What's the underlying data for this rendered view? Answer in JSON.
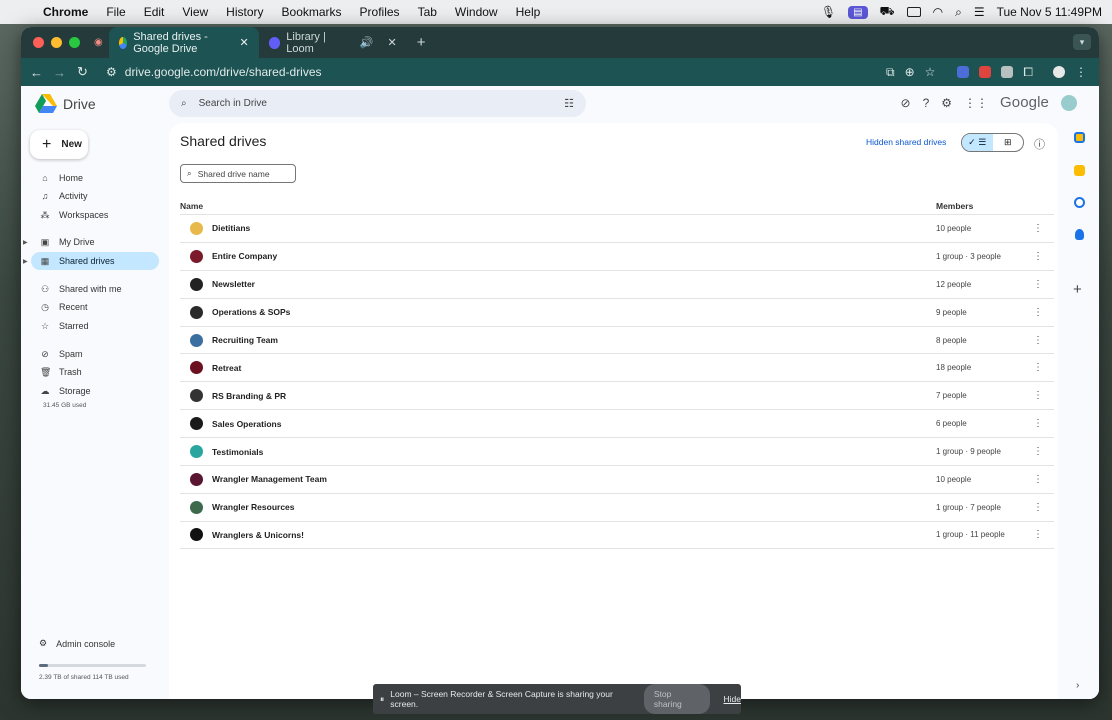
{
  "menubar": {
    "app": "Chrome",
    "items": [
      "File",
      "Edit",
      "View",
      "History",
      "Bookmarks",
      "Profiles",
      "Tab",
      "Window",
      "Help"
    ],
    "clock": "Tue Nov 5  11:49PM"
  },
  "tabs": [
    {
      "label": "Shared drives - Google Drive",
      "active": true
    },
    {
      "label": "Library | Loom",
      "active": false
    }
  ],
  "address": {
    "url": "drive.google.com/drive/shared-drives"
  },
  "drive": {
    "logo": "Drive",
    "new_label": "New",
    "search_placeholder": "Search in Drive",
    "google": "Google",
    "nav": [
      {
        "label": "Home",
        "icon": "home-icon"
      },
      {
        "label": "Activity",
        "icon": "bell-icon"
      },
      {
        "label": "Workspaces",
        "icon": "workspaces-icon"
      },
      {
        "label": "My Drive",
        "icon": "my-drive-icon"
      },
      {
        "label": "Shared drives",
        "icon": "shared-drives-icon"
      },
      {
        "label": "Shared with me",
        "icon": "people-icon"
      },
      {
        "label": "Recent",
        "icon": "clock-icon"
      },
      {
        "label": "Starred",
        "icon": "star-icon"
      },
      {
        "label": "Spam",
        "icon": "spam-icon"
      },
      {
        "label": "Trash",
        "icon": "trash-icon"
      },
      {
        "label": "Storage",
        "icon": "cloud-icon"
      }
    ],
    "storage_used": "31.45 GB used",
    "admin_label": "Admin console",
    "shared_storage": "2.39 TB of shared 114 TB used",
    "shared_storage_fraction": 0.021,
    "page_title": "Shared drives",
    "hidden_link": "Hidden shared drives",
    "drive_search_placeholder": "Shared drive name",
    "columns": {
      "name": "Name",
      "members": "Members"
    },
    "rows": [
      {
        "name": "Dietitians",
        "members": "10 people",
        "color": "#e6b94a"
      },
      {
        "name": "Entire Company",
        "members": "1 group · 3 people",
        "color": "#7a1a2a"
      },
      {
        "name": "Newsletter",
        "members": "12 people",
        "color": "#222222"
      },
      {
        "name": "Operations & SOPs",
        "members": "9 people",
        "color": "#2b2b2b"
      },
      {
        "name": "Recruiting Team",
        "members": "8 people",
        "color": "#3a6fa0"
      },
      {
        "name": "Retreat",
        "members": "18 people",
        "color": "#6a1020"
      },
      {
        "name": "RS Branding & PR",
        "members": "7 people",
        "color": "#333333"
      },
      {
        "name": "Sales Operations",
        "members": "6 people",
        "color": "#1a1a1a"
      },
      {
        "name": "Testimonials",
        "members": "1 group · 9 people",
        "color": "#2aa6a0"
      },
      {
        "name": "Wrangler Management Team",
        "members": "10 people",
        "color": "#5a1630"
      },
      {
        "name": "Wrangler Resources",
        "members": "1 group · 7 people",
        "color": "#3d6a4a"
      },
      {
        "name": "Wranglers & Unicorns!",
        "members": "1 group · 11 people",
        "color": "#111111"
      }
    ]
  },
  "loom": {
    "message": "Loom – Screen Recorder & Screen Capture is sharing your screen.",
    "stop": "Stop sharing",
    "hide": "Hide"
  }
}
